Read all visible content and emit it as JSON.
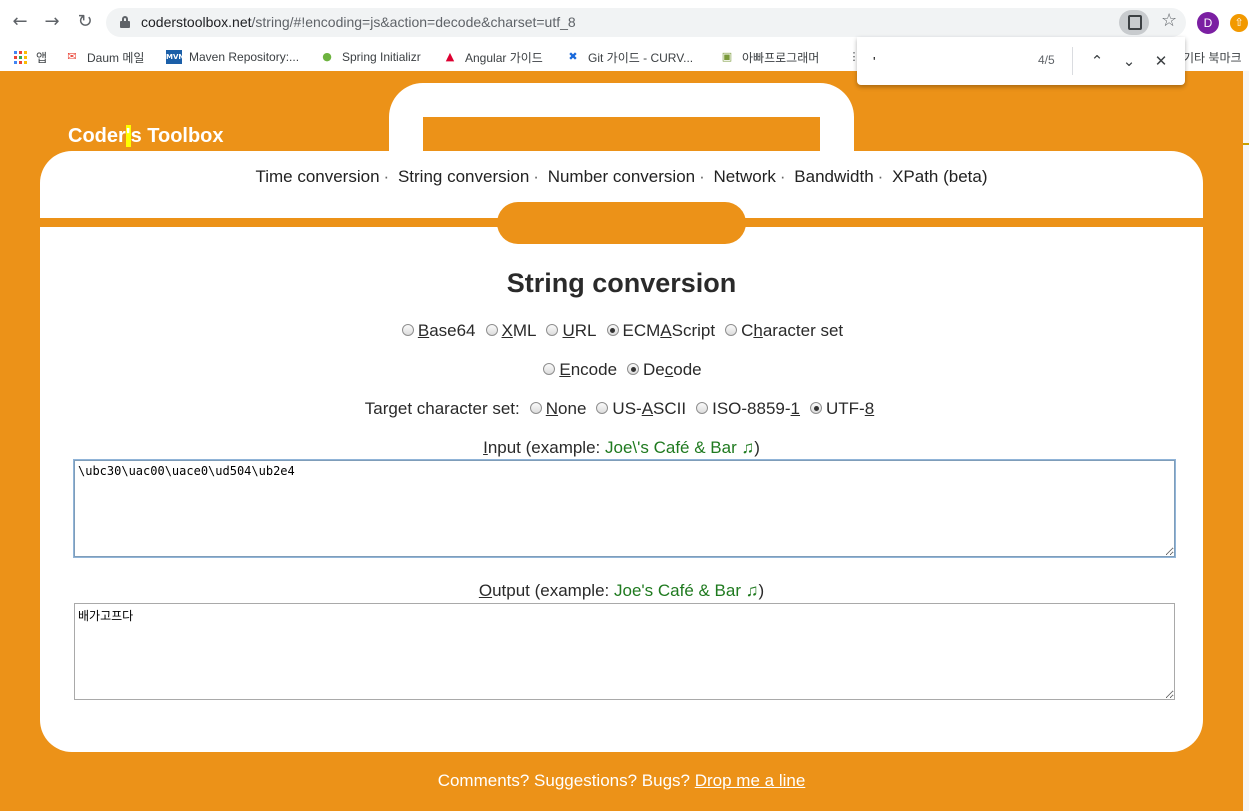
{
  "browser": {
    "url_host": "coderstoolbox.net",
    "url_path": "/string/#!encoding=js&action=decode&charset=utf_8",
    "avatar_letter": "D",
    "bookmarks": [
      {
        "label": "앱",
        "icon": "apps-grid-icon"
      },
      {
        "label": "Daum 메일",
        "icon": "mail-icon"
      },
      {
        "label": "Maven Repository:...",
        "icon": "maven-icon"
      },
      {
        "label": "Spring Initializr",
        "icon": "spring-icon"
      },
      {
        "label": "Angular 가이드",
        "icon": "angular-icon"
      },
      {
        "label": "Git 가이드 - CURV...",
        "icon": "confluence-icon"
      },
      {
        "label": "아빠프로그래머",
        "icon": "blog-icon"
      },
      {
        "label": "기타 북마크",
        "icon": "folder-icon"
      }
    ],
    "find": {
      "query": "'",
      "count": "4/5"
    }
  },
  "site": {
    "brand_pre": "Coder",
    "brand_hl": "'",
    "brand_post": "s Toolbox",
    "nav": [
      "Time conversion",
      "String conversion",
      "Number conversion",
      "Network",
      "Bandwidth",
      "XPath (beta)"
    ],
    "heading": "String conversion",
    "encoding_options": [
      {
        "pre": "",
        "key": "B",
        "post": "ase64",
        "checked": false
      },
      {
        "pre": "",
        "key": "X",
        "post": "ML",
        "checked": false
      },
      {
        "pre": "",
        "key": "U",
        "post": "RL",
        "checked": false
      },
      {
        "pre": "ECM",
        "key": "A",
        "post": "Script",
        "checked": true
      },
      {
        "pre": "C",
        "key": "h",
        "post": "aracter set",
        "checked": false
      }
    ],
    "action_options": [
      {
        "pre": "",
        "key": "E",
        "post": "ncode",
        "checked": false
      },
      {
        "pre": "De",
        "key": "c",
        "post": "ode",
        "checked": true
      }
    ],
    "charset_label": "Target character set:",
    "charset_options": [
      {
        "pre": "",
        "key": "N",
        "post": "one",
        "checked": false
      },
      {
        "pre": "US-",
        "key": "A",
        "post": "SCII",
        "checked": false
      },
      {
        "pre": "ISO-8859-",
        "key": "1",
        "post": "",
        "checked": false
      },
      {
        "pre": "UTF-",
        "key": "8",
        "post": "",
        "checked": true
      }
    ],
    "input_label_key": "I",
    "input_label_rest": "nput (example: ",
    "input_example": "Joe\\'s Café & Bar ♫",
    "input_value": "\\ubc30\\uac00\\uace0\\ud504\\ub2e4",
    "output_label_key": "O",
    "output_label_rest": "utput (example: ",
    "output_example": "Joe's Café & Bar ♫",
    "output_value": "배가고프다",
    "close_paren": ")",
    "footer_text": "Comments? Suggestions? Bugs?",
    "footer_link": "Drop me a line"
  },
  "colors": {
    "accent": "#ec9218",
    "example_green": "#1f7a1f"
  }
}
